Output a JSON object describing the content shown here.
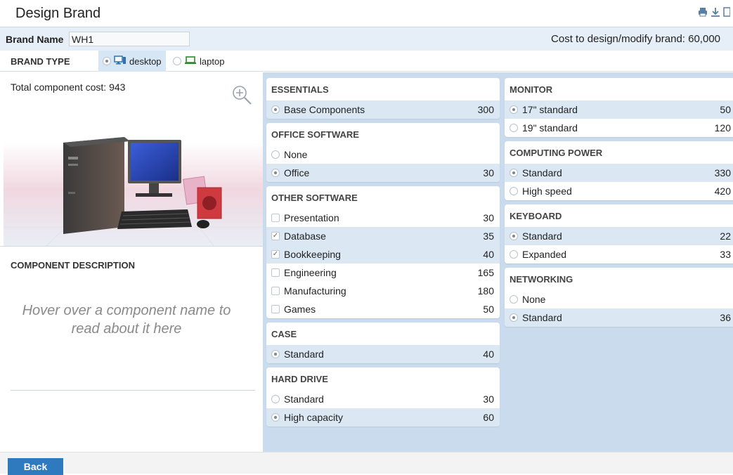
{
  "header": {
    "title": "Design Brand"
  },
  "brand": {
    "label": "Brand Name",
    "value": "WH1",
    "cost_text": "Cost to design/modify brand: 60,000"
  },
  "brand_type": {
    "label": "BRAND TYPE",
    "options": [
      {
        "label": "desktop",
        "selected": true
      },
      {
        "label": "laptop",
        "selected": false
      }
    ]
  },
  "left": {
    "total_text": "Total component cost: 943",
    "description_heading": "COMPONENT DESCRIPTION",
    "hover_text": "Hover over a component name to read about it here"
  },
  "column1": [
    {
      "heading": "ESSENTIALS",
      "type": "radio",
      "rows": [
        {
          "label": "Base Components",
          "price": "300",
          "selected": true
        }
      ]
    },
    {
      "heading": "OFFICE SOFTWARE",
      "type": "radio",
      "rows": [
        {
          "label": "None",
          "price": "",
          "selected": false
        },
        {
          "label": "Office",
          "price": "30",
          "selected": true
        }
      ]
    },
    {
      "heading": "OTHER SOFTWARE",
      "type": "check",
      "rows": [
        {
          "label": "Presentation",
          "price": "30",
          "selected": false
        },
        {
          "label": "Database",
          "price": "35",
          "selected": true
        },
        {
          "label": "Bookkeeping",
          "price": "40",
          "selected": true
        },
        {
          "label": "Engineering",
          "price": "165",
          "selected": false
        },
        {
          "label": "Manufacturing",
          "price": "180",
          "selected": false
        },
        {
          "label": "Games",
          "price": "50",
          "selected": false
        }
      ]
    },
    {
      "heading": "CASE",
      "type": "radio",
      "rows": [
        {
          "label": "Standard",
          "price": "40",
          "selected": true
        }
      ]
    },
    {
      "heading": "HARD DRIVE",
      "type": "radio",
      "rows": [
        {
          "label": "Standard",
          "price": "30",
          "selected": false
        },
        {
          "label": "High capacity",
          "price": "60",
          "selected": true
        }
      ]
    }
  ],
  "column2": [
    {
      "heading": "MONITOR",
      "type": "radio",
      "rows": [
        {
          "label": "17\" standard",
          "price": "50",
          "selected": true
        },
        {
          "label": "19\" standard",
          "price": "120",
          "selected": false
        }
      ]
    },
    {
      "heading": "COMPUTING POWER",
      "type": "radio",
      "rows": [
        {
          "label": "Standard",
          "price": "330",
          "selected": true
        },
        {
          "label": "High speed",
          "price": "420",
          "selected": false
        }
      ]
    },
    {
      "heading": "KEYBOARD",
      "type": "radio",
      "rows": [
        {
          "label": "Standard",
          "price": "22",
          "selected": true
        },
        {
          "label": "Expanded",
          "price": "33",
          "selected": false
        }
      ]
    },
    {
      "heading": "NETWORKING",
      "type": "radio",
      "rows": [
        {
          "label": "None",
          "price": "",
          "selected": false
        },
        {
          "label": "Standard",
          "price": "36",
          "selected": true
        }
      ]
    }
  ],
  "footer": {
    "back_label": "Back"
  },
  "colors": {
    "accent": "#2f79bf",
    "selected_row": "#dbe7f3",
    "options_bg": "#c9dbed"
  }
}
